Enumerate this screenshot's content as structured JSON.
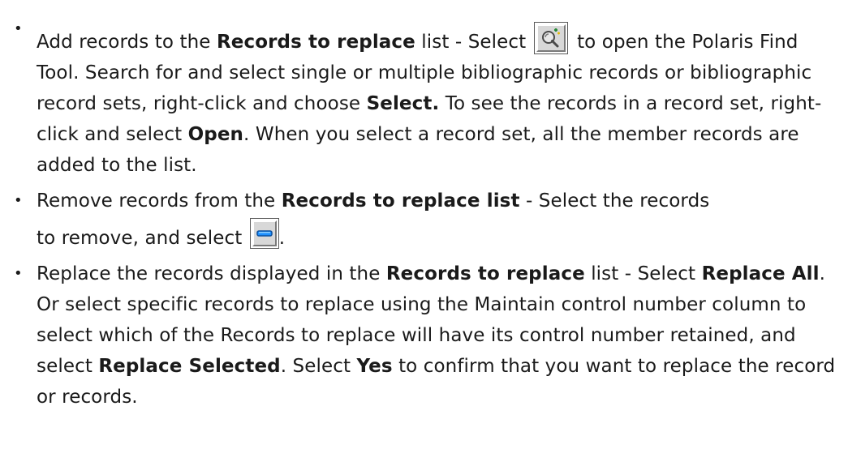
{
  "items": [
    {
      "p1": "Add records to the ",
      "b1": "Records to replace",
      "p2": " list - Select ",
      "icon": "find-tool-icon",
      "p3": " to open the Polaris Find Tool. Search for and select single or multiple bibliographic records or bibliographic record sets, right-click and choose ",
      "b2": "Select.",
      "p4": " To see the records in a record set, right-click and select ",
      "b3": "Open",
      "p5": ". When you select a record set, all the member records are added to the list."
    },
    {
      "p1": "Remove records from the ",
      "b1": "Records to replace list",
      "p2": " - Select the records",
      "p3": "to remove, and select ",
      "icon": "remove-icon",
      "p4": "."
    },
    {
      "p1": "Replace the records displayed in the ",
      "b1": "Records to replace",
      "p2": " list - Select ",
      "b2": "Replace All",
      "p3": ". Or select specific records to replace using the Maintain control number column to select which of the Records to replace will have its control number retained, and select ",
      "b3": "Replace Selected",
      "p4": ". Select ",
      "b4": "Yes",
      "p5": " to confirm that you want to replace the record or records."
    }
  ],
  "bullet": "•",
  "colors": {
    "text": "#1a1a1a",
    "icon_face": "#d8d8d8",
    "find_icon_accent": "#2a8a3a",
    "remove_icon_accent": "#1e90ff"
  }
}
